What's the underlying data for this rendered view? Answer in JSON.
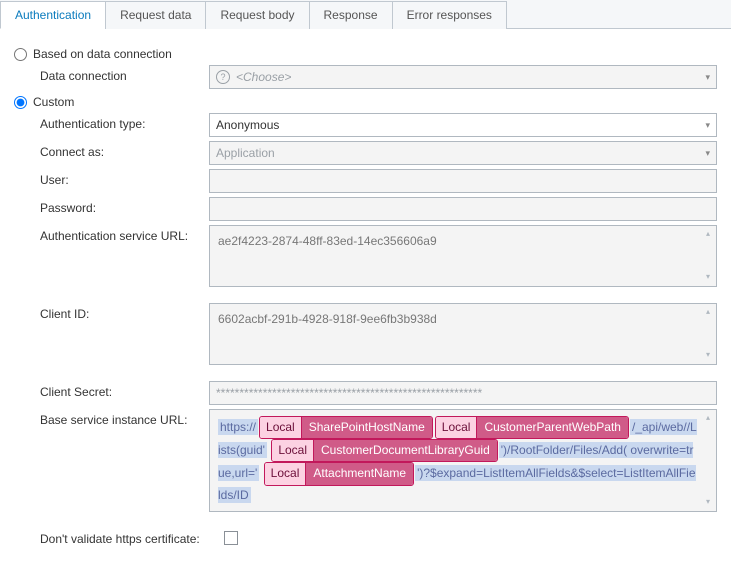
{
  "tabs": {
    "authentication": "Authentication",
    "request_data": "Request data",
    "request_body": "Request body",
    "response": "Response",
    "error_responses": "Error responses"
  },
  "mode": {
    "based_on_dc": "Based on data connection",
    "custom": "Custom"
  },
  "labels": {
    "data_connection": "Data connection",
    "auth_type": "Authentication type:",
    "connect_as": "Connect as:",
    "user": "User:",
    "password": "Password:",
    "auth_service_url": "Authentication service URL:",
    "client_id": "Client ID:",
    "client_secret": "Client Secret:",
    "base_url": "Base service instance URL:",
    "dont_validate": "Don't validate https certificate:"
  },
  "values": {
    "data_connection_placeholder": "<Choose>",
    "auth_type": "Anonymous",
    "connect_as": "Application",
    "user": "",
    "password": "",
    "auth_service_url": "ae2f4223-2874-48ff-83ed-14ec356606a9",
    "client_id": "6602acbf-291b-4928-918f-9ee6fb3b938d",
    "client_secret": "*********************************************************",
    "dont_validate_checked": false
  },
  "url_parts": {
    "p0": "https://",
    "p1": "/_api/web//Lists(guid'",
    "p2": "')/RootFolder/Files/Add( overwrite=true,url='",
    "p3": "')?$expand=ListItemAllFields&$select=ListItemAllFields/ID",
    "var_scope": "Local",
    "var1": "SharePointHostName",
    "var2": "CustomerParentWebPath",
    "var3": "CustomerDocumentLibraryGuid",
    "var4": "AttachmentName"
  }
}
